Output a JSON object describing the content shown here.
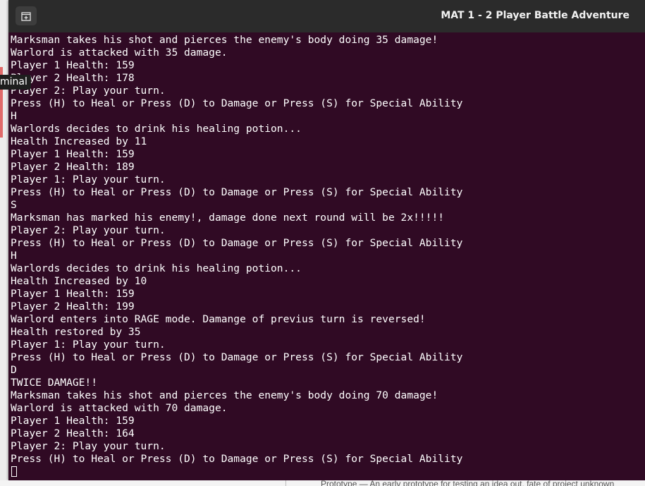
{
  "window": {
    "title": "MAT 1 - 2 Player Battle Adventure",
    "new_tab_icon": "new-tab-icon"
  },
  "tooltip": {
    "text": "minal"
  },
  "background_page": {
    "text": "Prototype — An early prototype for testing an idea out, fate of project unknown"
  },
  "colors": {
    "terminal_bg": "#300a24",
    "titlebar_bg": "#2b2b2b",
    "text": "#ffffff"
  },
  "terminal": {
    "lines": [
      "Marksman takes his shot and pierces the enemy's body doing 35 damage!",
      "Warlord is attacked with 35 damage.",
      "Player 1 Health: 159",
      "Player 2 Health: 178",
      "Player 2: Play your turn.",
      "Press (H) to Heal or Press (D) to Damage or Press (S) for Special Ability",
      "H",
      "Warlords decides to drink his healing potion...",
      "Health Increased by 11",
      "Player 1 Health: 159",
      "Player 2 Health: 189",
      "Player 1: Play your turn.",
      "Press (H) to Heal or Press (D) to Damage or Press (S) for Special Ability",
      "S",
      "Marksman has marked his enemy!, damage done next round will be 2x!!!!!",
      "Player 2: Play your turn.",
      "Press (H) to Heal or Press (D) to Damage or Press (S) for Special Ability",
      "H",
      "Warlords decides to drink his healing potion...",
      "Health Increased by 10",
      "Player 1 Health: 159",
      "Player 2 Health: 199",
      "Warlord enters into RAGE mode. Damange of previus turn is reversed!",
      "Health restored by 35",
      "Player 1: Play your turn.",
      "Press (H) to Heal or Press (D) to Damage or Press (S) for Special Ability",
      "D",
      "TWICE DAMAGE!!",
      "Marksman takes his shot and pierces the enemy's body doing 70 damage!",
      "Warlord is attacked with 70 damage.",
      "Player 1 Health: 159",
      "Player 2 Health: 164",
      "Player 2: Play your turn.",
      "Press (H) to Heal or Press (D) to Damage or Press (S) for Special Ability"
    ]
  }
}
